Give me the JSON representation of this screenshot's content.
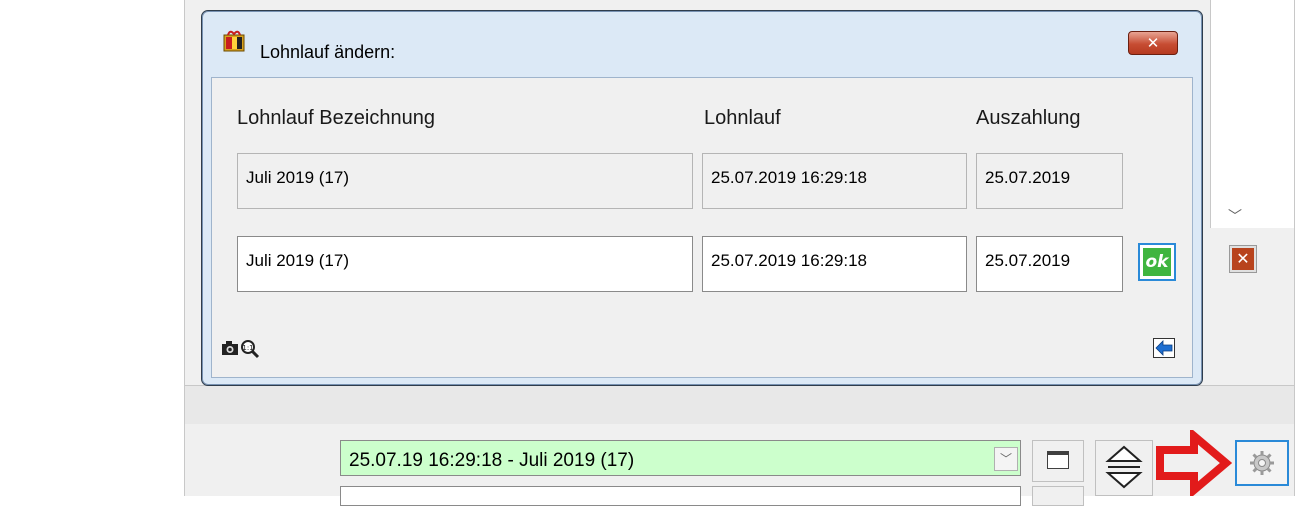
{
  "dialog": {
    "title": "Lohnlauf ändern:",
    "close_label": "✕",
    "columns": {
      "bezeichnung": "Lohnlauf Bezeichnung",
      "lohnlauf": "Lohnlauf",
      "auszahlung": "Auszahlung"
    },
    "current_row": {
      "bezeichnung": "Juli 2019 (17)",
      "lohnlauf": "25.07.2019 16:29:18",
      "auszahlung": "25.07.2019"
    },
    "edit_row": {
      "bezeichnung": "Juli 2019 (17)",
      "lohnlauf": "25.07.2019 16:29:18",
      "auszahlung": "25.07.2019"
    },
    "ok_label": "ok",
    "footer_icons": [
      "camera-icon",
      "zoom-icon",
      "back-arrow-icon"
    ]
  },
  "main": {
    "lohnlauf_select_value": "25.07.19 16:29:18 - Juli 2019 (17)",
    "delete_label": "✕"
  },
  "colors": {
    "dialog_bg": "#dce9f6",
    "select_green": "#ccffcc",
    "ok_green": "#3fb53f",
    "focus_blue": "#2a8ad8",
    "arrow_red": "#e21b1b",
    "close_red": "#c74d33"
  }
}
